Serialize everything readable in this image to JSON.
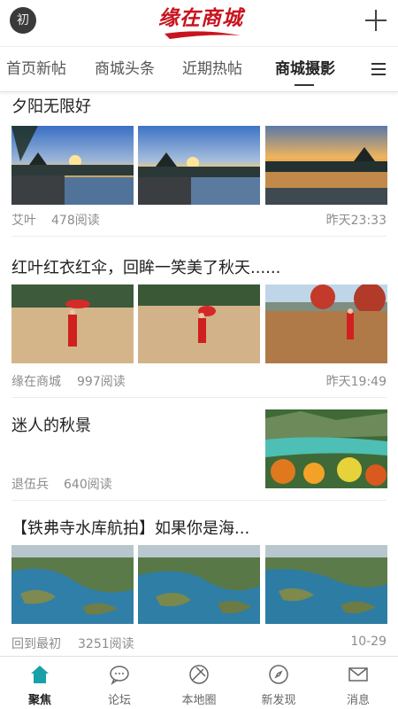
{
  "header": {
    "avatar_text": "初",
    "logo_text": "缘在商城",
    "add_icon": "plus-icon"
  },
  "tabs": [
    {
      "label": "首页新帖",
      "active": false
    },
    {
      "label": "商城头条",
      "active": false
    },
    {
      "label": "近期热帖",
      "active": false
    },
    {
      "label": "商城摄影",
      "active": true
    }
  ],
  "menu_icon": "hamburger-menu-icon",
  "posts": [
    {
      "title": "夕阳无限好",
      "author": "艾叶",
      "reads": "478阅读",
      "time": "昨天23:33",
      "images": [
        "sunset-pavilion-photo",
        "sunset-pavilion-photo",
        "sunset-lake-photo"
      ]
    },
    {
      "title": "红叶红衣红伞，回眸一笑美了秋天......",
      "author": "缘在商城",
      "reads": "997阅读",
      "time": "昨天19:49",
      "images": [
        "red-umbrella-woman-photo",
        "red-umbrella-woman-photo",
        "autumn-tree-woman-photo"
      ]
    },
    {
      "title": "迷人的秋景",
      "author": "退伍兵",
      "reads": "640阅读",
      "time": "",
      "images": [
        "autumn-lake-valley-photo"
      ]
    },
    {
      "title": "【铁弗寺水库航拍】如果你是海...",
      "author": "回到最初",
      "reads": "3251阅读",
      "time": "10-29",
      "images": [
        "reservoir-aerial-photo",
        "reservoir-aerial-photo",
        "reservoir-aerial-photo"
      ]
    }
  ],
  "bottom_nav": [
    {
      "label": "聚焦",
      "icon": "home-icon",
      "active": true
    },
    {
      "label": "论坛",
      "icon": "chat-bubble-icon",
      "active": false
    },
    {
      "label": "本地圈",
      "icon": "circle-icon",
      "active": false
    },
    {
      "label": "新发现",
      "icon": "compass-icon",
      "active": false
    },
    {
      "label": "消息",
      "icon": "mail-icon",
      "active": false
    }
  ],
  "colors": {
    "brand_red": "#c8141e",
    "active_nav": "#1aa0a8",
    "meta_gray": "#8c8c8c"
  }
}
